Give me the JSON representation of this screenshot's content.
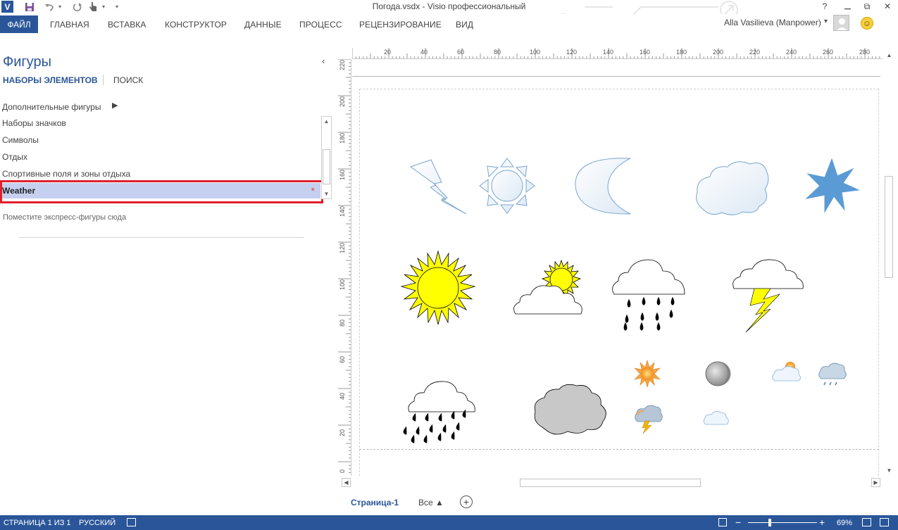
{
  "titlebar": {
    "app_letter": "V",
    "document_title": "Погода.vsdx -  Visio профессиональный",
    "help": "?",
    "restore": "⧉",
    "close": "✕"
  },
  "ribbon": {
    "tabs": [
      {
        "label": "ФАЙЛ"
      },
      {
        "label": "ГЛАВНАЯ"
      },
      {
        "label": "ВСТАВКА"
      },
      {
        "label": "КОНСТРУКТОР"
      },
      {
        "label": "ДАННЫЕ"
      },
      {
        "label": "ПРОЦЕСС"
      },
      {
        "label": "РЕЦЕНЗИРОВАНИЕ"
      },
      {
        "label": "ВИД"
      }
    ],
    "user_name": "Alla Vasilieva (Manpower)",
    "user_dropdown": "▾"
  },
  "shapes_pane": {
    "title": "Фигуры",
    "collapse_glyph": "‹",
    "tab_stencils": "НАБОРЫ ЭЛЕМЕНТОВ",
    "tab_search": "ПОИСК",
    "more_shapes": "Дополнительные фигуры",
    "more_arrow": "▶",
    "stencils": [
      {
        "label": "Наборы значков"
      },
      {
        "label": "Символы"
      },
      {
        "label": "Отдых"
      },
      {
        "label": "Спортивные поля и зоны отдыха"
      },
      {
        "label": "Weather"
      }
    ],
    "weather_modified_marker": "*",
    "quick_shapes_hint": "Поместите экспресс-фигуры сюда"
  },
  "rulers": {
    "horizontal": [
      "20",
      "40",
      "60",
      "80",
      "100",
      "120",
      "140",
      "160",
      "180",
      "200",
      "220",
      "240",
      "260",
      "280"
    ],
    "vertical": [
      "220",
      "200",
      "180",
      "160",
      "140",
      "120",
      "100",
      "80",
      "60",
      "40",
      "20",
      "0"
    ]
  },
  "page_tabs": {
    "current": "Страница-1",
    "all": "Все ▲",
    "add": "+"
  },
  "statusbar": {
    "page": "СТРАНИЦА 1 ИЗ 1",
    "language": "РУССКИЙ",
    "zoom_minus": "−",
    "zoom_plus": "+",
    "zoom_level": "69%",
    "zoom_fraction": 0.32
  },
  "colors": {
    "brand": "#2a5699",
    "highlight_border": "#e0202a",
    "selected_row": "#c5cff0",
    "sun_yellow": "#ffff00",
    "star_blue": "#5b9bd5",
    "cloud_gray": "#c8c8c8"
  }
}
